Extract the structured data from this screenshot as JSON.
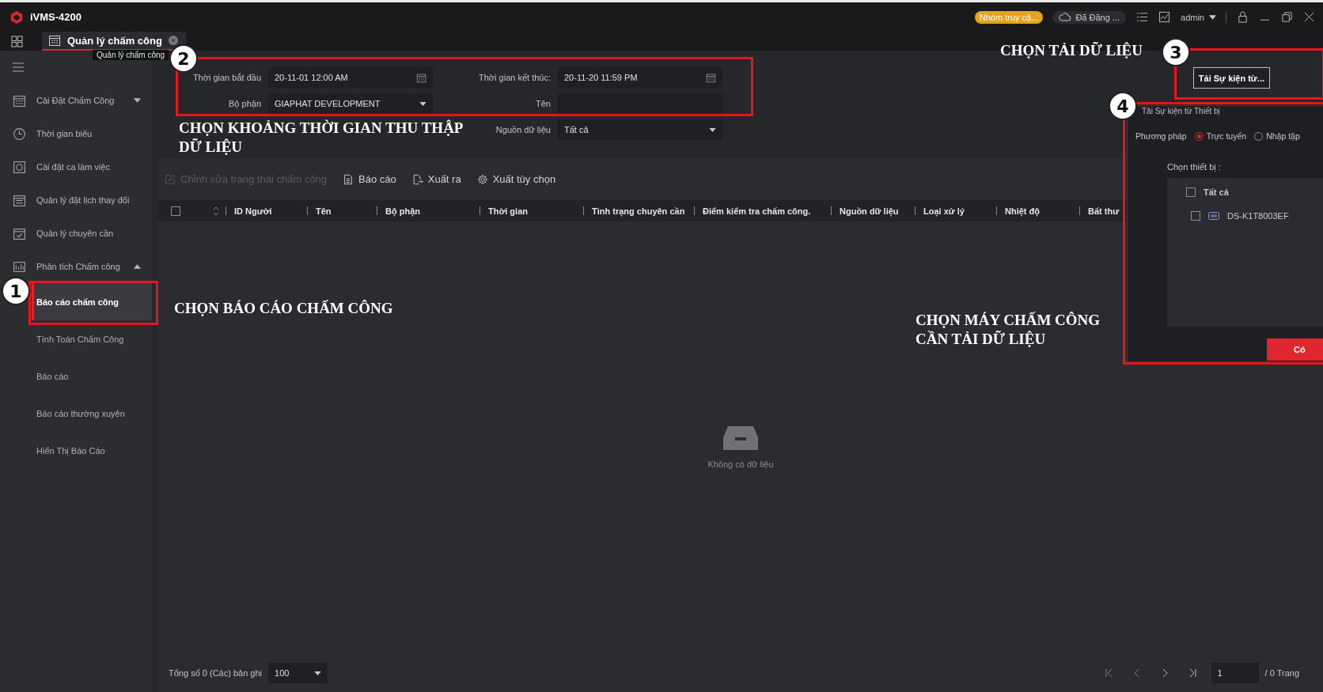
{
  "window": {
    "title": "iVMS-4200"
  },
  "header": {
    "access_group": "Nhóm truy cậ...",
    "cloud": "Đã Đăng ...",
    "user": "admin"
  },
  "module_tab": {
    "label": "Quản lý chấm công",
    "selected": true,
    "tooltip": "Quản lý chấm công"
  },
  "sidebar": {
    "items": [
      {
        "label": "Cài Đặt Chấm Công",
        "kind": "calendar",
        "expanded": false
      },
      {
        "label": "Thời gian biểu",
        "kind": "clock"
      },
      {
        "label": "Cài đặt ca làm việc",
        "kind": "shift"
      },
      {
        "label": "Quản lý đặt lịch thay đổi",
        "kind": "schedule"
      },
      {
        "label": "Quản lý chuyên cần",
        "kind": "check"
      },
      {
        "label": "Phân tích Chấm công",
        "kind": "chart",
        "expanded": true,
        "children": [
          {
            "label": "Báo cáo chấm công",
            "selected": true
          },
          {
            "label": "Tính Toán Chấm Công",
            "selected": false
          },
          {
            "label": "Báo cáo",
            "selected": false
          },
          {
            "label": "Báo cáo thường xuyên",
            "selected": false
          },
          {
            "label": "Hiển Thị Báo Cáo",
            "selected": false
          }
        ]
      }
    ]
  },
  "filters": {
    "start_time": {
      "label": "Thời gian bắt đầu",
      "value": "20-11-01 12:00 AM"
    },
    "end_time": {
      "label": "Thời gian kết thúc:",
      "value": "20-11-20 11:59 PM"
    },
    "department": {
      "label": "Bộ phận",
      "value": "GIAPHAT DEVELOPMENT"
    },
    "name": {
      "label": "Tên"
    },
    "data_source": {
      "label": "Nguồn dữ liệu",
      "value": "Tất cả"
    }
  },
  "download_button": "Tải Sự kiện từ...",
  "toolbar": [
    {
      "label": "Chỉnh sửa trạng thái chấm công",
      "kind": "edit",
      "disabled": true
    },
    {
      "label": "Báo cáo",
      "kind": "document",
      "disabled": false
    },
    {
      "label": "Xuất ra",
      "kind": "export",
      "disabled": false
    },
    {
      "label": "Xuất tùy chọn",
      "kind": "gear",
      "disabled": false
    }
  ],
  "table": {
    "select_all_checked": false,
    "columns": [
      "ID Người",
      "Tên",
      "Bộ phận",
      "Thời gian",
      "Tình trạng chuyên cần",
      "Điểm kiểm tra chấm công.",
      "Nguồn dữ liệu",
      "Loại xử lý",
      "Nhiệt độ",
      "Bất thư"
    ],
    "empty_text": "Không có dữ liệu"
  },
  "footer": {
    "total": "Tổng số 0 (Các) bản ghi",
    "page_size": "100",
    "page": "1",
    "page_total": "/ 0 Trang"
  },
  "dialog": {
    "title": "Tải Sự kiện từ Thiết bị",
    "method_label": "Phương pháp",
    "methods": [
      {
        "label": "Trực tuyến",
        "selected": true
      },
      {
        "label": "Nhập tập",
        "selected": false
      }
    ],
    "device_label": "Chọn thiết bị :",
    "all": {
      "label": "Tất cả",
      "checked": false
    },
    "devices": [
      {
        "name": "DS-K1T8003EF",
        "checked": false
      }
    ],
    "confirm": "Có"
  },
  "step_markers": [
    {
      "number": "3"
    },
    {
      "number": "2"
    },
    {
      "number": "4"
    },
    {
      "number": "1"
    }
  ],
  "captions": [
    "CHỌN TẢI DỮ LIỆU",
    "CHỌN KHOẢNG THỜI GIAN THU THẬP DỮ LIỆU",
    "CHỌN BÁO CÁO CHẤM CÔNG",
    "CHỌN MÁY CHẤM CÔNG CẦN TẢI DỮ LIỆU"
  ]
}
